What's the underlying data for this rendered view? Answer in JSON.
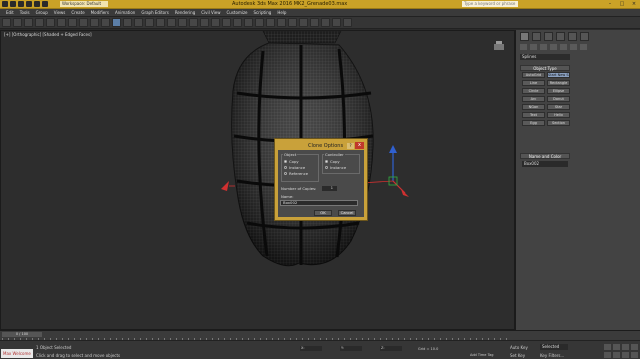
{
  "titlebar": {
    "app_title": "Autodesk 3ds Max 2016      MK2_Grenade03.max",
    "workspace": "Workspace: Default",
    "search_placeholder": "Type a keyword or phrase",
    "minimize": "–",
    "maximize": "□",
    "close": "×"
  },
  "menubar": {
    "items": [
      "Edit",
      "Tools",
      "Group",
      "Views",
      "Create",
      "Modifiers",
      "Animation",
      "Graph Editors",
      "Rendering",
      "Civil View",
      "Customize",
      "Scripting",
      "Help"
    ]
  },
  "viewport": {
    "label": "[+] [Orthographic] [Shaded + Edged Faces]"
  },
  "command_panel": {
    "category": "Splines",
    "object_type_title": "Object Type",
    "object_buttons": [
      "AutoGrid",
      "Start New Shape",
      "Line",
      "Rectangle",
      "Circle",
      "Ellipse",
      "Arc",
      "Donut",
      "NGon",
      "Star",
      "Text",
      "Helix",
      "Egg",
      "Section"
    ],
    "name_color_title": "Name and Color",
    "name_value": "Box002"
  },
  "clone_dialog": {
    "title": "Clone Options",
    "help": "?",
    "close": "x",
    "object_group": "Object",
    "object_options": [
      "Copy",
      "Instance",
      "Reference"
    ],
    "controller_group": "Controller",
    "controller_options": [
      "Copy",
      "Instance"
    ],
    "copies_label": "Number of Copies:",
    "copies_value": "1",
    "name_label": "Name:",
    "name_value": "Box002",
    "ok": "OK",
    "cancel": "Cancel"
  },
  "timeline": {
    "slider": "0 / 100"
  },
  "statusbar": {
    "maxscript": "Max Welcome",
    "selection": "1 Object Selected",
    "hint": "Click and drag to select and move objects",
    "x_label": "X:",
    "y_label": "Y:",
    "z_label": "Z:",
    "grid": "Grid = 10.0",
    "add_time_tag": "Add Time Tag",
    "auto_key": "Auto Key",
    "selected": "Selected",
    "set_key": "Set Key",
    "key_filters": "Key Filters..."
  },
  "colors": {
    "titlebar": "#caa227",
    "dialog_frame": "#c9a13a",
    "axis_x": "#d03030",
    "axis_y": "#3060d0",
    "axis_z": "#30b040",
    "background": "#2b2b2b"
  }
}
